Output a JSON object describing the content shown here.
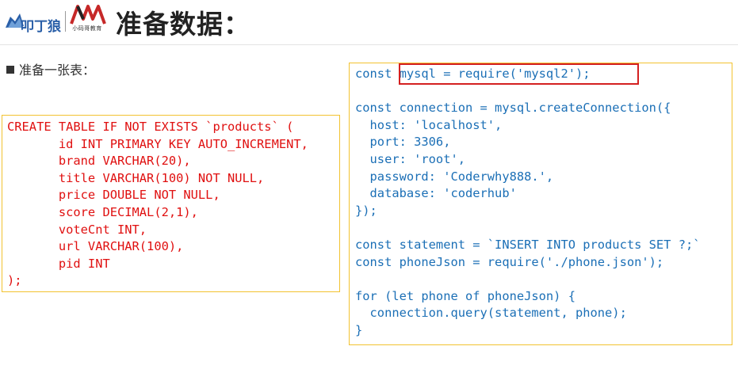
{
  "header": {
    "logo_coder": "Coder logo",
    "logo_xmg_caption": "小码哥教育",
    "title": "准备数据："
  },
  "content": {
    "bullet_text": "准备一张表："
  },
  "sql_code": {
    "lines": [
      "CREATE TABLE IF NOT EXISTS `products` (",
      "       id INT PRIMARY KEY AUTO_INCREMENT,",
      "       brand VARCHAR(20),",
      "       title VARCHAR(100) NOT NULL,",
      "       price DOUBLE NOT NULL,",
      "       score DECIMAL(2,1),",
      "       voteCnt INT,",
      "       url VARCHAR(100),",
      "       pid INT",
      ");"
    ]
  },
  "js_code": {
    "lines": [
      "const mysql = require('mysql2');",
      "",
      "const connection = mysql.createConnection({",
      "  host: 'localhost',",
      "  port: 3306,",
      "  user: 'root',",
      "  password: 'Coderwhy888.',",
      "  database: 'coderhub'",
      "});",
      "",
      "const statement = `INSERT INTO products SET ?;`",
      "const phoneJson = require('./phone.json');",
      "",
      "for (let phone of phoneJson) {",
      "  connection.query(statement, phone);",
      "}"
    ]
  },
  "colors": {
    "sql_text": "#e01010",
    "js_text": "#1b6fb6",
    "box_border": "#f2c230",
    "highlight_border": "#d42020"
  }
}
